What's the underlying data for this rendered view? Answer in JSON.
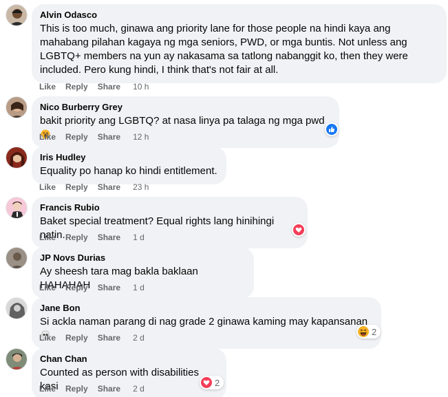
{
  "actions": {
    "like": "Like",
    "reply": "Reply",
    "share": "Share"
  },
  "comments": [
    {
      "name": "Alvin Odasco",
      "lines": [
        "This is too much, ginawa ang priority lane for those people na hindi kaya ang",
        "mahabang pilahan kagaya ng mga seniors, PWD, or mga buntis. Not unless ang",
        "LGBTQ+ members na yun ay nakasama sa tatlong nabanggit ko, then they were",
        "included. Pero kung hindi, I think that's not fair at all."
      ],
      "time": "10 h"
    },
    {
      "name": "Nico Burberry Grey",
      "lines": [
        "bakit priority ang LGBTQ? at nasa linya pa talaga ng mga pwd"
      ],
      "time": "12 h",
      "reaction": "like",
      "inline_emoji": "scream"
    },
    {
      "name": "Iris Hudley",
      "lines": [
        "Equality po hanap ko hindi entitlement."
      ],
      "time": "23 h"
    },
    {
      "name": "Francis Rubio",
      "lines": [
        "Baket special treatment? Equal rights lang hinihingi natin."
      ],
      "time": "1 d",
      "reaction": "love"
    },
    {
      "name": "JP Novs Durias",
      "lines": [
        "Ay sheesh tara mag bakla baklaan HAHAHAH"
      ],
      "time": "1 d"
    },
    {
      "name": "Jane Bon",
      "lines": [
        "Si ackla naman parang di nag grade 2 ginawa kaming may kapansanan"
      ],
      "time": "2 d",
      "reaction": "haha",
      "reaction_count": "2",
      "inline_emoji": "skull"
    },
    {
      "name": "Chan Chan",
      "lines": [
        "Counted as person with disabilities kasi"
      ],
      "time": "2 d",
      "reaction": "love",
      "reaction_count": "2"
    }
  ],
  "colors": {
    "bubble": "#f0f2f5",
    "secondary_text": "#65676b",
    "like_blue": "#1877f2",
    "love_red": "#f33e58",
    "haha_yellow": "#f7b125"
  }
}
